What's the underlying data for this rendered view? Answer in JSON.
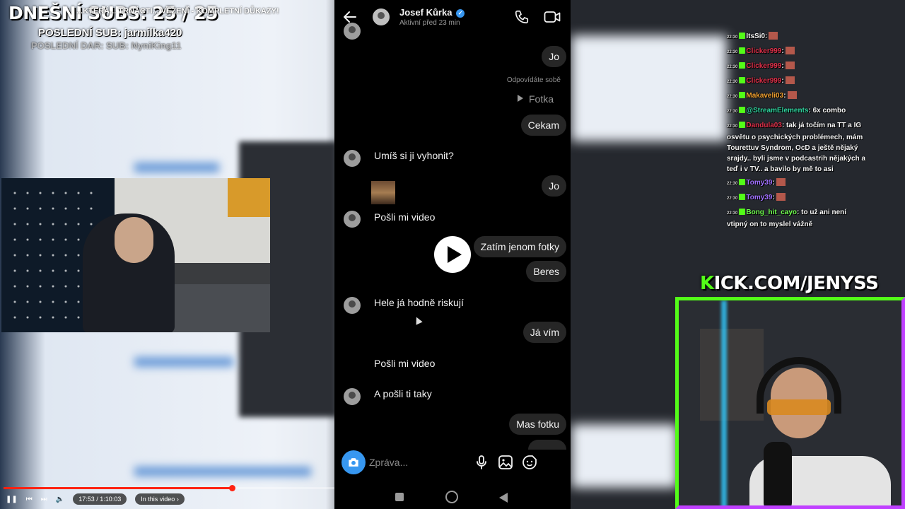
{
  "overlay": {
    "subs_today": "DNEŠNÍ SUBS: 25 / 25",
    "video_title": "...KTERÁ... TRNÁCTI... VĚZENÍ - KOMPLETNÍ DŮKAZY!",
    "last_sub": "POSLEDNÍ SUB: jarmilka420",
    "last_dar": "POSLEDNÍ DAR: SUB: NyniKing11"
  },
  "video_player": {
    "progress": 0.69,
    "time": "17:53 / 1:10:03",
    "in_this_video": "In this video"
  },
  "dm": {
    "contact_name": "Josef Kůrka",
    "status": "Aktivní před 23 min",
    "reply_note": "Odpovídáte sobě",
    "photo_reply": "Fotka",
    "messages": [
      {
        "side": "out",
        "text": "Jo"
      },
      {
        "side": "out",
        "text": "Cekam"
      },
      {
        "side": "in",
        "text": "Umíš si ji vyhonit?"
      },
      {
        "side": "out",
        "text": "Jo"
      },
      {
        "side": "in",
        "text": "Pošli mi video"
      },
      {
        "side": "out",
        "text": "Zatím jenom fotky"
      },
      {
        "side": "out",
        "text": "Beres"
      },
      {
        "side": "in",
        "text": "Hele já hodně riskují"
      },
      {
        "side": "out",
        "text": "Já vím"
      },
      {
        "side": "in",
        "text": "Pošli mi video"
      },
      {
        "side": "in",
        "text": "A pošli ti taky"
      },
      {
        "side": "out",
        "text": "Mas fotku"
      }
    ],
    "composer_placeholder": "Zpráva..."
  },
  "chat": {
    "colors": {
      "green": "#53fc18",
      "purple": "#c040ff",
      "red": "#e0304a",
      "orange": "#f0a030",
      "teal": "#2fd6a0",
      "violet": "#a070ff",
      "lime": "#70ff50"
    },
    "messages": [
      {
        "time": "22:30",
        "user": "ItsSi0",
        "text": ":",
        "color": "#f5f5f5"
      },
      {
        "time": "22:30",
        "user": "Clicker999",
        "text": ":",
        "color": "#e0304a"
      },
      {
        "time": "22:30",
        "user": "Clicker999",
        "text": ":",
        "color": "#e0304a"
      },
      {
        "time": "22:30",
        "user": "Clicker999",
        "text": ":",
        "color": "#e0304a"
      },
      {
        "time": "22:30",
        "user": "Makaveli03",
        "text": ":",
        "color": "#f0a030"
      },
      {
        "time": "22:30",
        "user": "@StreamElements",
        "text": ": 6x combo",
        "color": "#2fd6a0"
      },
      {
        "time": "22:30",
        "user": "Dandula03",
        "text": ": tak já točím na TT a IG osvětu o psychických problémech, mám Tourettuv Syndrom, OcD a ještě nějaký srajdy.. byli jsme v podcastrih nějakých a teď i v TV.. a bavilo by mě to asi",
        "color": "#e0304a"
      },
      {
        "time": "22:30",
        "user": "Tomy39",
        "text": ":",
        "color": "#a070ff"
      },
      {
        "time": "22:30",
        "user": "Tomy39",
        "text": ":",
        "color": "#a070ff"
      },
      {
        "time": "22:30",
        "user": "Bong_hit_cayo",
        "text": ": to už ani není vtipný on to myslel vážně",
        "color": "#70ff50"
      }
    ]
  },
  "kick": {
    "k": "K",
    "rest": "ICK.COM/JENYSS"
  }
}
